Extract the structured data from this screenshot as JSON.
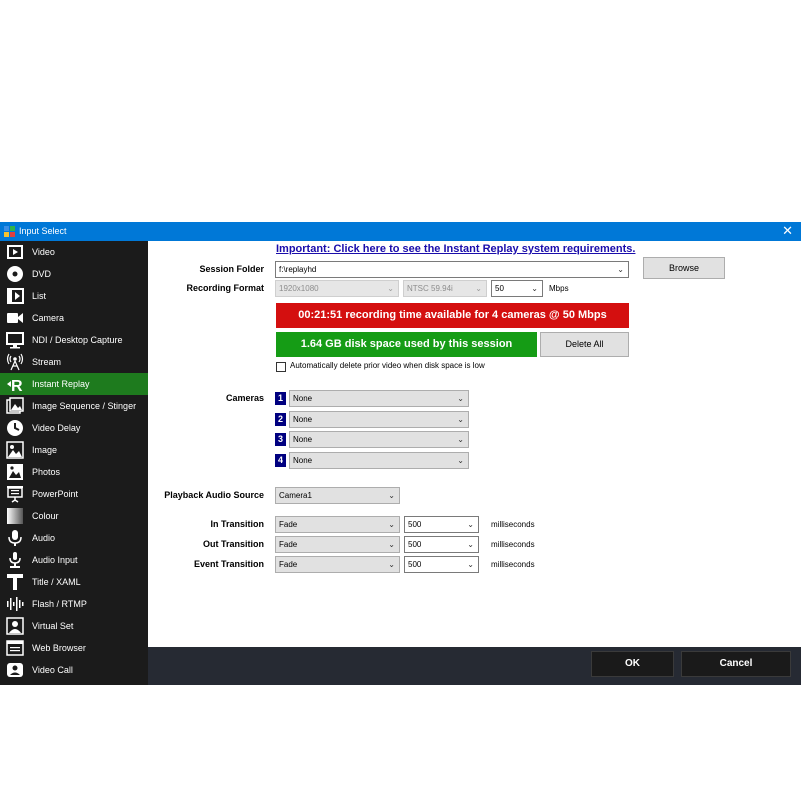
{
  "window": {
    "title": "Input Select",
    "close_glyph": "✕"
  },
  "sidebar": {
    "items": [
      {
        "label": "Video",
        "icon": "film-icon"
      },
      {
        "label": "DVD",
        "icon": "disc-icon"
      },
      {
        "label": "List",
        "icon": "playlist-icon"
      },
      {
        "label": "Camera",
        "icon": "camera-icon"
      },
      {
        "label": "NDI / Desktop Capture",
        "icon": "monitor-icon"
      },
      {
        "label": "Stream",
        "icon": "broadcast-icon"
      },
      {
        "label": "Instant Replay",
        "icon": "replay-icon",
        "active": true
      },
      {
        "label": "Image Sequence / Stinger",
        "icon": "image-sequence-icon"
      },
      {
        "label": "Video Delay",
        "icon": "clock-icon"
      },
      {
        "label": "Image",
        "icon": "image-icon"
      },
      {
        "label": "Photos",
        "icon": "photos-icon"
      },
      {
        "label": "PowerPoint",
        "icon": "presentation-icon"
      },
      {
        "label": "Colour",
        "icon": "colour-icon"
      },
      {
        "label": "Audio",
        "icon": "microphone-icon"
      },
      {
        "label": "Audio Input",
        "icon": "audio-input-icon"
      },
      {
        "label": "Title / XAML",
        "icon": "title-icon"
      },
      {
        "label": "Flash / RTMP",
        "icon": "waveform-icon"
      },
      {
        "label": "Virtual Set",
        "icon": "virtual-set-icon"
      },
      {
        "label": "Web Browser",
        "icon": "browser-icon"
      },
      {
        "label": "Video Call",
        "icon": "video-call-icon"
      }
    ],
    "active_color": "#1e7b1e"
  },
  "main": {
    "requirements_link": "Important: Click here to see the Instant Replay system requirements.",
    "session_folder": {
      "label": "Session Folder",
      "value": "f:\\replayhd",
      "browse": "Browse"
    },
    "recording_format": {
      "label": "Recording Format",
      "resolution": "1920x1080",
      "framerate": "NTSC 59.94i",
      "bitrate": "50",
      "unit": "Mbps"
    },
    "recording_time_banner": "00:21:51 recording time available for 4 cameras @ 50 Mbps",
    "disk_space_banner": "1.64 GB disk space used by this session",
    "delete_all": "Delete All",
    "auto_delete_label": "Automatically delete prior video when disk space is low",
    "auto_delete_checked": false,
    "cameras": {
      "label": "Cameras",
      "items": [
        {
          "num": "1",
          "value": "None"
        },
        {
          "num": "2",
          "value": "None"
        },
        {
          "num": "3",
          "value": "None"
        },
        {
          "num": "4",
          "value": "None"
        }
      ]
    },
    "playback_audio": {
      "label": "Playback Audio Source",
      "value": "Camera1"
    },
    "transitions": [
      {
        "label": "In Transition",
        "effect": "Fade",
        "duration": "500",
        "unit": "milliseconds"
      },
      {
        "label": "Out Transition",
        "effect": "Fade",
        "duration": "500",
        "unit": "milliseconds"
      },
      {
        "label": "Event Transition",
        "effect": "Fade",
        "duration": "500",
        "unit": "milliseconds"
      }
    ],
    "colors": {
      "red_banner": "#d40f0f",
      "green_banner": "#159c15",
      "camera_badge": "#000080"
    }
  },
  "footer": {
    "ok": "OK",
    "cancel": "Cancel"
  }
}
